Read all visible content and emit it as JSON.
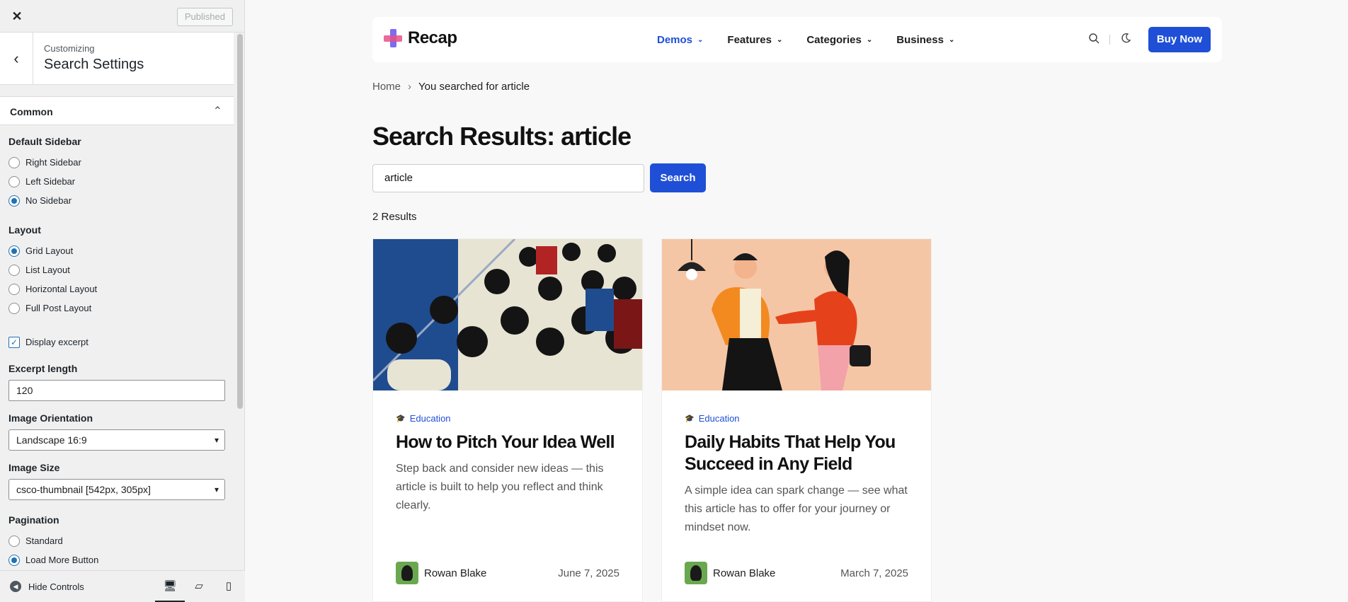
{
  "panel": {
    "publish_label": "Published",
    "customizing_label": "Customizing",
    "section_title": "Search Settings",
    "group_title": "Common",
    "default_sidebar": {
      "label": "Default Sidebar",
      "options": [
        "Right Sidebar",
        "Left Sidebar",
        "No Sidebar"
      ],
      "selected": "No Sidebar"
    },
    "layout": {
      "label": "Layout",
      "options": [
        "Grid Layout",
        "List Layout",
        "Horizontal Layout",
        "Full Post Layout"
      ],
      "selected": "Grid Layout"
    },
    "display_excerpt_label": "Display excerpt",
    "excerpt_length": {
      "label": "Excerpt length",
      "value": "120"
    },
    "image_orientation": {
      "label": "Image Orientation",
      "value": "Landscape 16:9"
    },
    "image_size": {
      "label": "Image Size",
      "value": "csco-thumbnail [542px, 305px]"
    },
    "pagination": {
      "label": "Pagination",
      "options": [
        "Standard",
        "Load More Button"
      ],
      "selected": "Load More Button"
    },
    "hide_controls_label": "Hide Controls"
  },
  "site": {
    "brand": "Recap",
    "nav": [
      "Demos",
      "Features",
      "Categories",
      "Business"
    ],
    "buy_label": "Buy Now",
    "breadcrumb": {
      "home": "Home",
      "current": "You searched for article"
    },
    "heading": "Search Results: article",
    "search_value": "article",
    "search_button": "Search",
    "results_count": "2 Results",
    "posts": [
      {
        "category": "Education",
        "title": "How to Pitch Your Idea Well",
        "excerpt": "Step back and consider new ideas — this article is built to help you reflect and think clearly.",
        "author": "Rowan Blake",
        "date": "June 7, 2025"
      },
      {
        "category": "Education",
        "title": "Daily Habits That Help You Succeed in Any Field",
        "excerpt": "A simple idea can spark change — see what this article has to offer for your journey or mindset now.",
        "author": "Rowan Blake",
        "date": "March 7, 2025"
      }
    ]
  },
  "colors": {
    "accent": "#1f4fd6",
    "wp_blue": "#2271b1"
  }
}
